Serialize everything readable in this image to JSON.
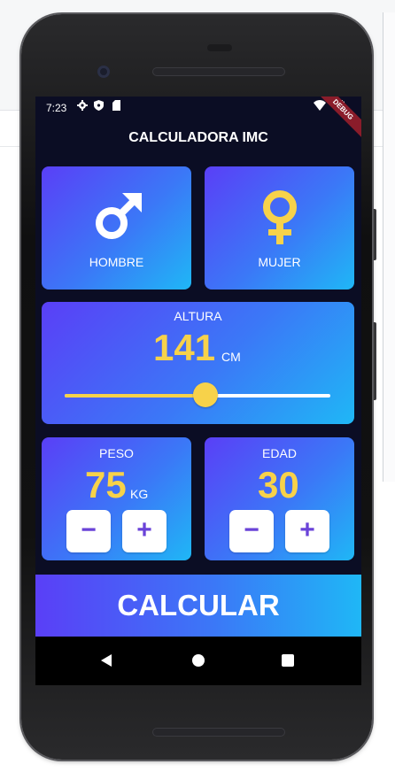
{
  "status_bar": {
    "time": "7:23",
    "icons": [
      "settings-icon",
      "shield-icon",
      "sd-card-icon",
      "wifi-icon",
      "battery-icon"
    ],
    "debug_banner": "DEBUG"
  },
  "app": {
    "title": "CALCULADORA IMC",
    "accent_color": "#f7d24a",
    "card_gradient": [
      "#5a3ff7",
      "#1fb7f6"
    ]
  },
  "gender": {
    "male_label": "HOMBRE",
    "female_label": "MUJER",
    "male_icon": "male-symbol-icon",
    "female_icon": "female-symbol-icon"
  },
  "height": {
    "label": "ALTURA",
    "value": "141",
    "unit": "CM",
    "slider_fraction": 0.53
  },
  "weight": {
    "label": "PESO",
    "value": "75",
    "unit": "KG",
    "minus": "−",
    "plus": "+"
  },
  "age": {
    "label": "EDAD",
    "value": "30",
    "minus": "−",
    "plus": "+"
  },
  "calculate": {
    "label": "CALCULAR"
  },
  "nav": {
    "icons": [
      "back-icon",
      "home-icon",
      "recents-icon"
    ]
  }
}
